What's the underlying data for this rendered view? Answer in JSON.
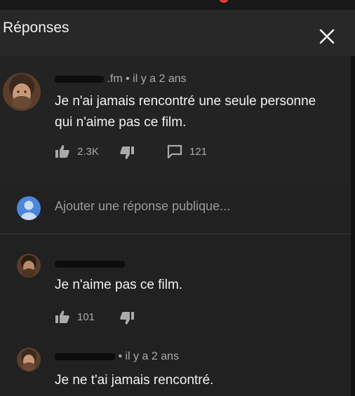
{
  "header": {
    "title": "Réponses"
  },
  "main_comment": {
    "author_visible": ".fm",
    "meta": "• il y a 2 ans",
    "text_line1": "Je n'ai jamais rencontré une seule personne",
    "text_line2": "qui n'aime pas ce film.",
    "likes": "2.3K",
    "replies_count": "121"
  },
  "reply_input": {
    "placeholder": "Ajouter une réponse publique..."
  },
  "reply1": {
    "text": "Je n'aime pas ce film.",
    "likes": "101"
  },
  "reply2": {
    "meta": "• il y a 2 ans",
    "text": "Je ne t'ai jamais rencontré."
  },
  "colors": {
    "background": "#212121",
    "header": "#282828",
    "accent_avatar": "#4a87db"
  },
  "icons": [
    "close-icon",
    "thumbs-up-icon",
    "thumbs-down-icon",
    "reply-comment-icon",
    "user-icon"
  ]
}
